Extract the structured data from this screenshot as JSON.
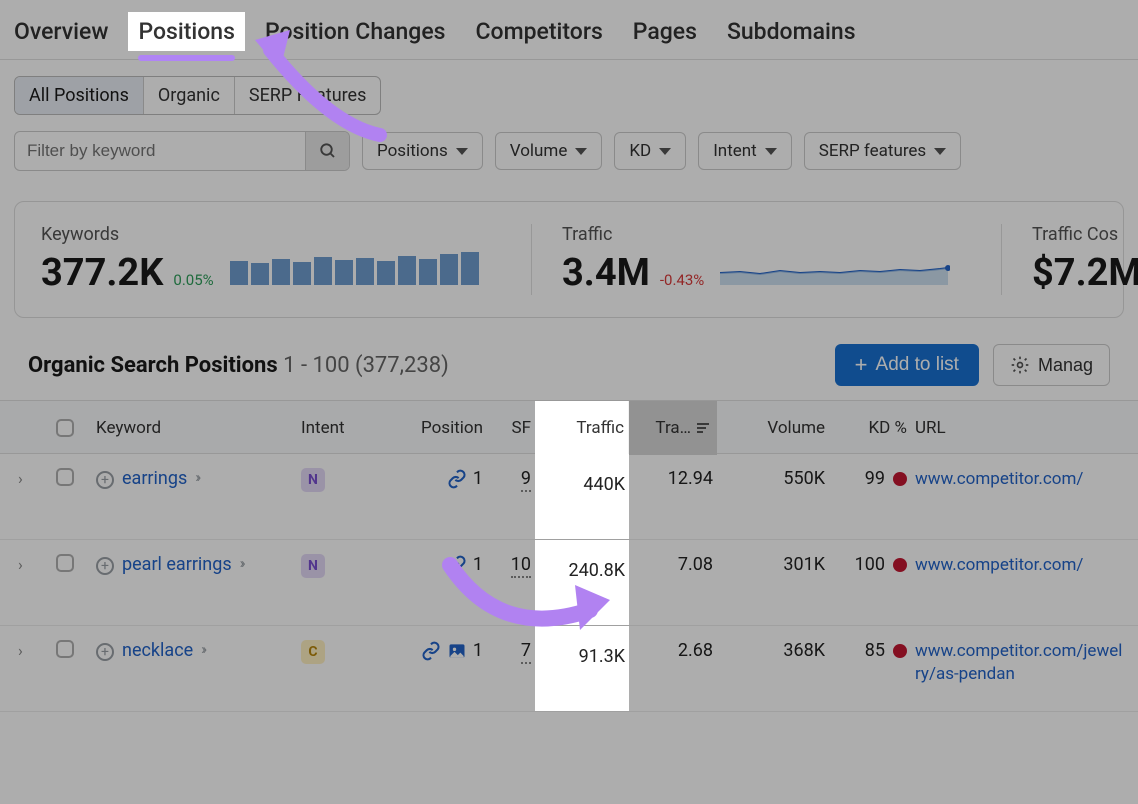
{
  "tabs": {
    "overview": "Overview",
    "positions": "Positions",
    "position_changes": "Position Changes",
    "competitors": "Competitors",
    "pages": "Pages",
    "subdomains": "Subdomains"
  },
  "subfilters": {
    "all": "All Positions",
    "organic": "Organic",
    "serp_features": "SERP Features"
  },
  "filter_row": {
    "search_placeholder": "Filter by keyword",
    "positions": "Positions",
    "volume": "Volume",
    "kd": "KD",
    "intent": "Intent",
    "serp_features": "SERP features"
  },
  "stats": {
    "keywords_label": "Keywords",
    "keywords_value": "377.2K",
    "keywords_delta": "0.05%",
    "traffic_label": "Traffic",
    "traffic_value": "3.4M",
    "traffic_delta": "-0.43%",
    "traffic_cost_label": "Traffic Cos",
    "traffic_cost_value": "$7.2M"
  },
  "section": {
    "title_bold": "Organic Search Positions",
    "title_range": "1 - 100 (377,238)",
    "add_to_list": "Add to list",
    "manage": "Manag"
  },
  "columns": {
    "keyword": "Keyword",
    "intent": "Intent",
    "position": "Position",
    "sf": "SF",
    "traffic": "Traffic",
    "tra": "Tra…",
    "volume": "Volume",
    "kd": "KD %",
    "url": "URL"
  },
  "rows": [
    {
      "keyword": "earrings",
      "intent": "N",
      "position": "1",
      "pos_icons": "link",
      "sf": "9",
      "traffic": "440K",
      "tra": "12.94",
      "volume": "550K",
      "kd": "99",
      "url": "www.competitor.com/"
    },
    {
      "keyword": "pearl earrings",
      "intent": "N",
      "position": "1",
      "pos_icons": "link",
      "sf": "10",
      "traffic": "240.8K",
      "tra": "7.08",
      "volume": "301K",
      "kd": "100",
      "url": "www.competitor.com/"
    },
    {
      "keyword": "necklace",
      "intent": "C",
      "position": "1",
      "pos_icons": "link_img",
      "sf": "7",
      "traffic": "91.3K",
      "tra": "2.68",
      "volume": "368K",
      "kd": "85",
      "url": "www.competitor.com/jewelry/as-pendan"
    }
  ]
}
